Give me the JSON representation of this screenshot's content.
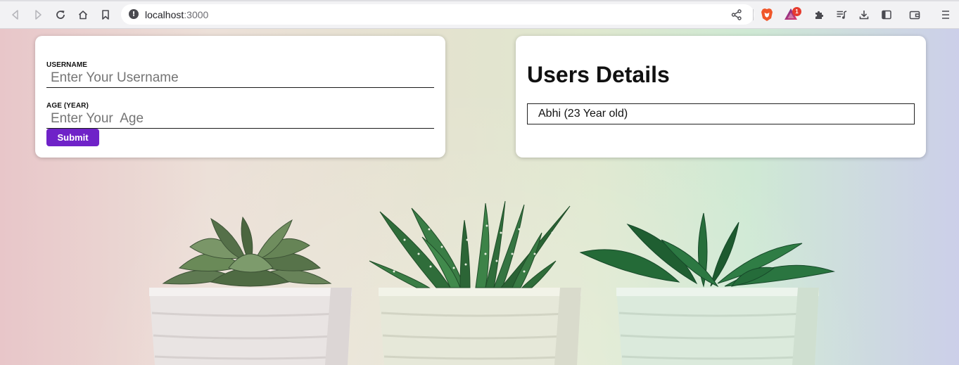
{
  "browser": {
    "url_host": "localhost",
    "url_port": ":3000",
    "info_glyph": "!",
    "rewards_badge": "1",
    "icons": {
      "back": "back-arrow-icon",
      "forward": "forward-arrow-icon",
      "reload": "reload-icon",
      "home": "home-icon",
      "bookmark": "bookmark-icon",
      "share": "share-icon",
      "brave_shields": "brave-lion-icon",
      "rewards": "brave-rewards-icon",
      "extensions": "puzzle-icon",
      "media": "playlist-icon",
      "downloads": "download-icon",
      "sidebar": "sidebar-icon",
      "wallet": "wallet-icon",
      "menu": "hamburger-menu-icon"
    }
  },
  "form": {
    "username_label": "USERNAME",
    "username_placeholder": "Enter Your Username",
    "username_value": "",
    "age_label": "AGE (YEAR)",
    "age_placeholder": "Enter Your  Age",
    "age_value": "",
    "submit_label": "Submit",
    "accent": "#6f22c8"
  },
  "users": {
    "title": "Users Details",
    "items": [
      {
        "text": "Abhi (23 Year old)"
      }
    ]
  }
}
